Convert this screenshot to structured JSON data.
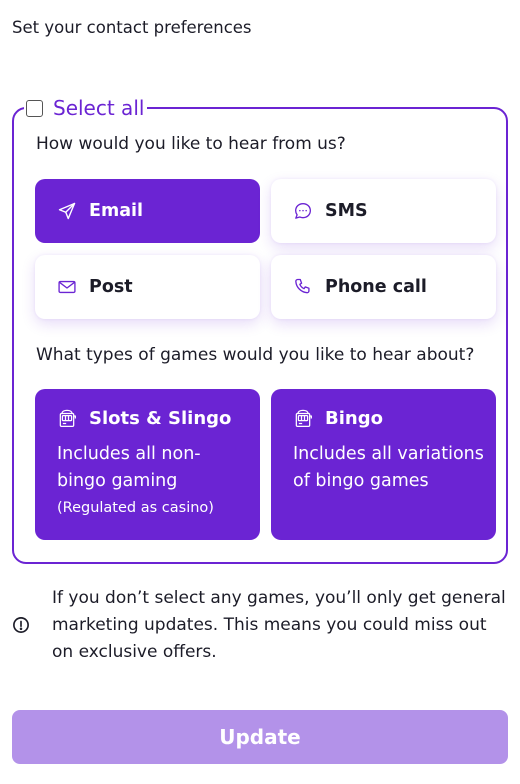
{
  "page": {
    "title": "Set your contact preferences"
  },
  "preferences": {
    "select_all_label": "Select all",
    "select_all_checked": false,
    "contact_question": "How would you like to hear from us?",
    "contact_methods": [
      {
        "label": "Email",
        "icon": "send-icon",
        "selected": true
      },
      {
        "label": "SMS",
        "icon": "chat-bubble-icon",
        "selected": false
      },
      {
        "label": "Post",
        "icon": "envelope-icon",
        "selected": false
      },
      {
        "label": "Phone call",
        "icon": "phone-icon",
        "selected": false
      }
    ],
    "games_question": "What types of games would you like to hear about?",
    "games": [
      {
        "title": "Slots & Slingo",
        "icon": "slot-machine-icon",
        "description": "Includes all non-bingo gaming",
        "note": "(Regulated as casino)",
        "selected": true
      },
      {
        "title": "Bingo",
        "icon": "slot-machine-icon",
        "description": "Includes all variations of bingo games",
        "note": "",
        "selected": true
      }
    ]
  },
  "info": {
    "icon": "info-icon",
    "text": "If you don’t select any games, you’ll only get general marketing updates. This means you could miss out on exclusive offers."
  },
  "actions": {
    "update_label": "Update"
  },
  "colors": {
    "accent": "#6b24d3",
    "button_disabled": "#b392e9",
    "text": "#1c1c28"
  }
}
